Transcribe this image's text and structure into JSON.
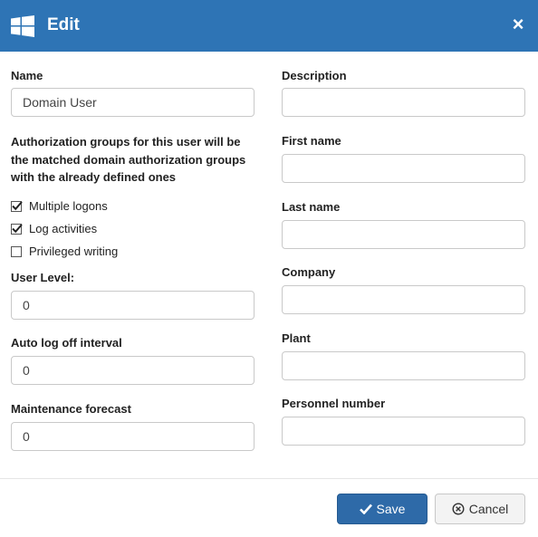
{
  "dialog": {
    "title": "Edit",
    "close_glyph": "×",
    "icon": "windows-logo-icon"
  },
  "left": {
    "name_label": "Name",
    "name_value": "Domain User",
    "info_text": "Authorization groups for this user will be the matched domain authorization groups with the already defined ones",
    "checkboxes": [
      {
        "label": "Multiple logons",
        "checked": true
      },
      {
        "label": "Log activities",
        "checked": true
      },
      {
        "label": "Privileged writing",
        "checked": false
      }
    ],
    "user_level_label": "User Level:",
    "user_level_value": "0",
    "auto_logoff_label": "Auto log off interval",
    "auto_logoff_value": "0",
    "maintenance_label": "Maintenance forecast",
    "maintenance_value": "0"
  },
  "right": {
    "description_label": "Description",
    "description_value": "",
    "first_name_label": "First name",
    "first_name_value": "",
    "last_name_label": "Last name",
    "last_name_value": "",
    "company_label": "Company",
    "company_value": "",
    "plant_label": "Plant",
    "plant_value": "",
    "personnel_label": "Personnel number",
    "personnel_value": ""
  },
  "footer": {
    "save_label": "Save",
    "cancel_label": "Cancel",
    "save_icon": "checkmark-icon",
    "cancel_icon": "circle-x-icon"
  },
  "colors": {
    "header": "#2e74b5",
    "save_button": "#2e6aa8",
    "cancel_button": "#f3f3f3"
  }
}
